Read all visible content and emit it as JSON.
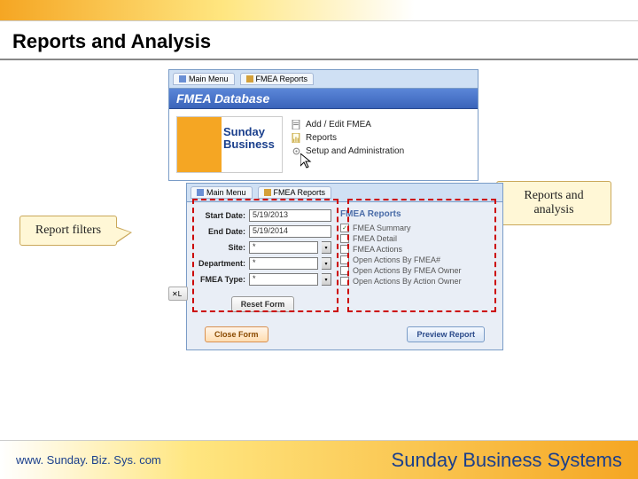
{
  "slide": {
    "title": "Reports and Analysis"
  },
  "callouts": {
    "filters": "Report filters",
    "reports": "Reports and analysis"
  },
  "win_back": {
    "tab1": "Main Menu",
    "tab2": "FMEA Reports",
    "title": "FMEA Database",
    "logo_line1": "Sunday",
    "logo_line2": "Business",
    "nav": {
      "add_edit": "Add / Edit FMEA",
      "reports": "Reports",
      "setup": "Setup and Administration"
    }
  },
  "win_front": {
    "tab1": "Main Menu",
    "tab2": "FMEA Reports",
    "filters": {
      "start_date_label": "Start Date:",
      "start_date_value": "5/19/2013",
      "end_date_label": "End Date:",
      "end_date_value": "5/19/2014",
      "site_label": "Site:",
      "site_value": "*",
      "dept_label": "Department:",
      "dept_value": "*",
      "type_label": "FMEA Type:",
      "type_value": "*"
    },
    "reports_title": "FMEA Reports",
    "reports": {
      "r1": "FMEA Summary",
      "r2": "FMEA Detail",
      "r3": "FMEA Actions",
      "r4": "Open Actions By FMEA#",
      "r5": "Open Actions By FMEA Owner",
      "r6": "Open Actions By Action Owner"
    },
    "buttons": {
      "reset": "Reset Form",
      "close": "Close Form",
      "preview": "Preview Report"
    },
    "lo_stub": "L"
  },
  "footer": {
    "url": "www. Sunday. Biz. Sys. com",
    "brand": "Sunday Business Systems"
  }
}
